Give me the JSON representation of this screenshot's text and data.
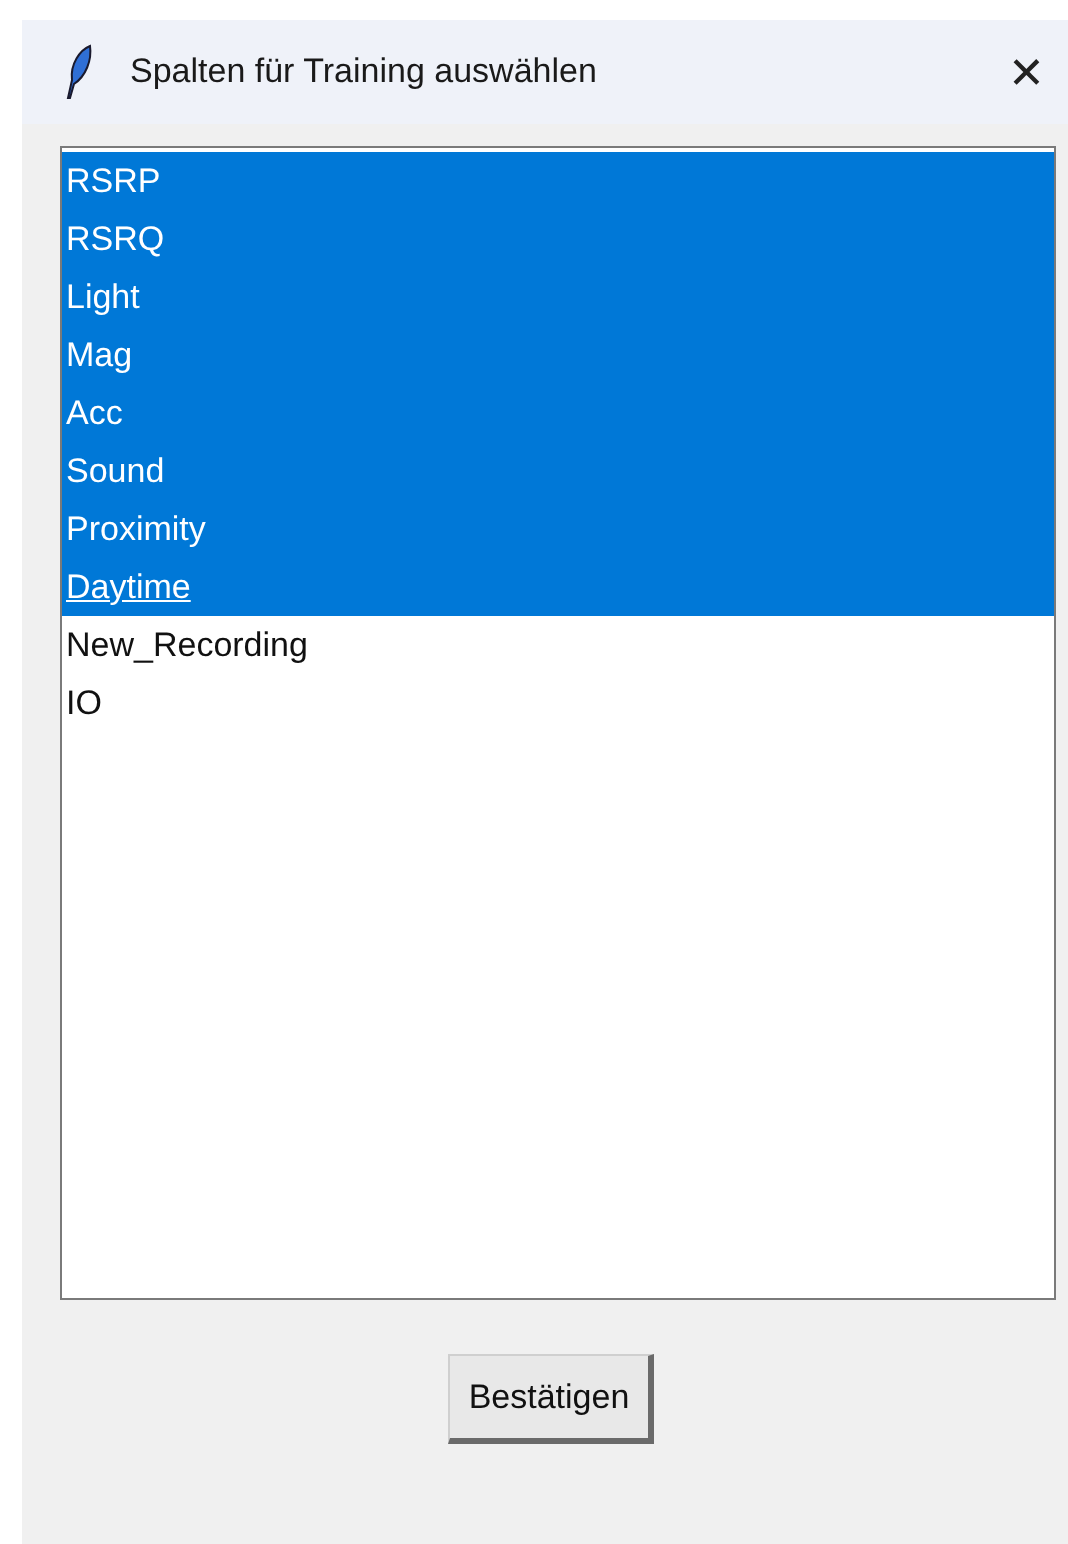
{
  "window": {
    "title": "Spalten für Training auswählen",
    "close": "✕"
  },
  "list": {
    "items": [
      {
        "label": "RSRP",
        "selected": true,
        "focused": false
      },
      {
        "label": "RSRQ",
        "selected": true,
        "focused": false
      },
      {
        "label": "Light",
        "selected": true,
        "focused": false
      },
      {
        "label": "Mag",
        "selected": true,
        "focused": false
      },
      {
        "label": "Acc",
        "selected": true,
        "focused": false
      },
      {
        "label": "Sound",
        "selected": true,
        "focused": false
      },
      {
        "label": "Proximity",
        "selected": true,
        "focused": false
      },
      {
        "label": "Daytime",
        "selected": true,
        "focused": true
      },
      {
        "label": "New_Recording",
        "selected": false,
        "focused": false
      },
      {
        "label": "IO",
        "selected": false,
        "focused": false
      }
    ]
  },
  "buttons": [
    "Bestätigen"
  ]
}
